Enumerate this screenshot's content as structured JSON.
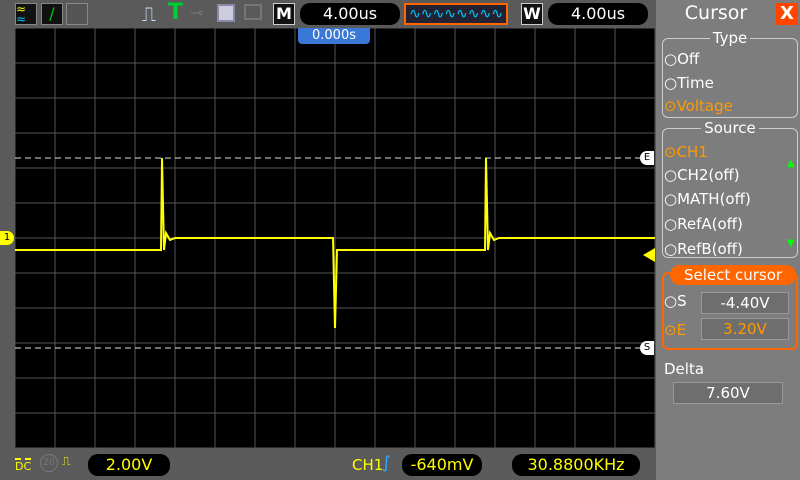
{
  "toolbar": {
    "icons": [
      "channels-icon",
      "line-icon",
      "persist-icon",
      "pulse-icon",
      "trigger-t-icon",
      "key-icon",
      "save-icon",
      "print-icon"
    ],
    "main_label": "M",
    "main_time": "4.00us",
    "window_label": "W",
    "window_time": "4.00us",
    "trigger_pos": "0.000s"
  },
  "panel": {
    "title": "Cursor",
    "close": "X",
    "type_title": "Type",
    "type_options": [
      "Off",
      "Time",
      "Voltage"
    ],
    "source_title": "Source",
    "source_options": [
      "CH1",
      "CH2(off)",
      "MATH(off)",
      "RefA(off)",
      "RefB(off)"
    ],
    "select_title": "Select cursor",
    "s_label": "S",
    "s_value": "-4.40V",
    "e_label": "E",
    "e_value": "3.20V",
    "delta_label": "Delta",
    "delta_value": "7.60V"
  },
  "markers": {
    "ch1": "1",
    "e": "E",
    "s": "S"
  },
  "status": {
    "coupling": "DC",
    "bw": "20",
    "ch1_scale": "2.00V",
    "trig_source": "CH1",
    "trig_level": "-640mV",
    "frequency": "30.8800KHz"
  },
  "colors": {
    "ch1": "#ffff00",
    "accent": "#ff6600",
    "time": "#3399ff"
  }
}
